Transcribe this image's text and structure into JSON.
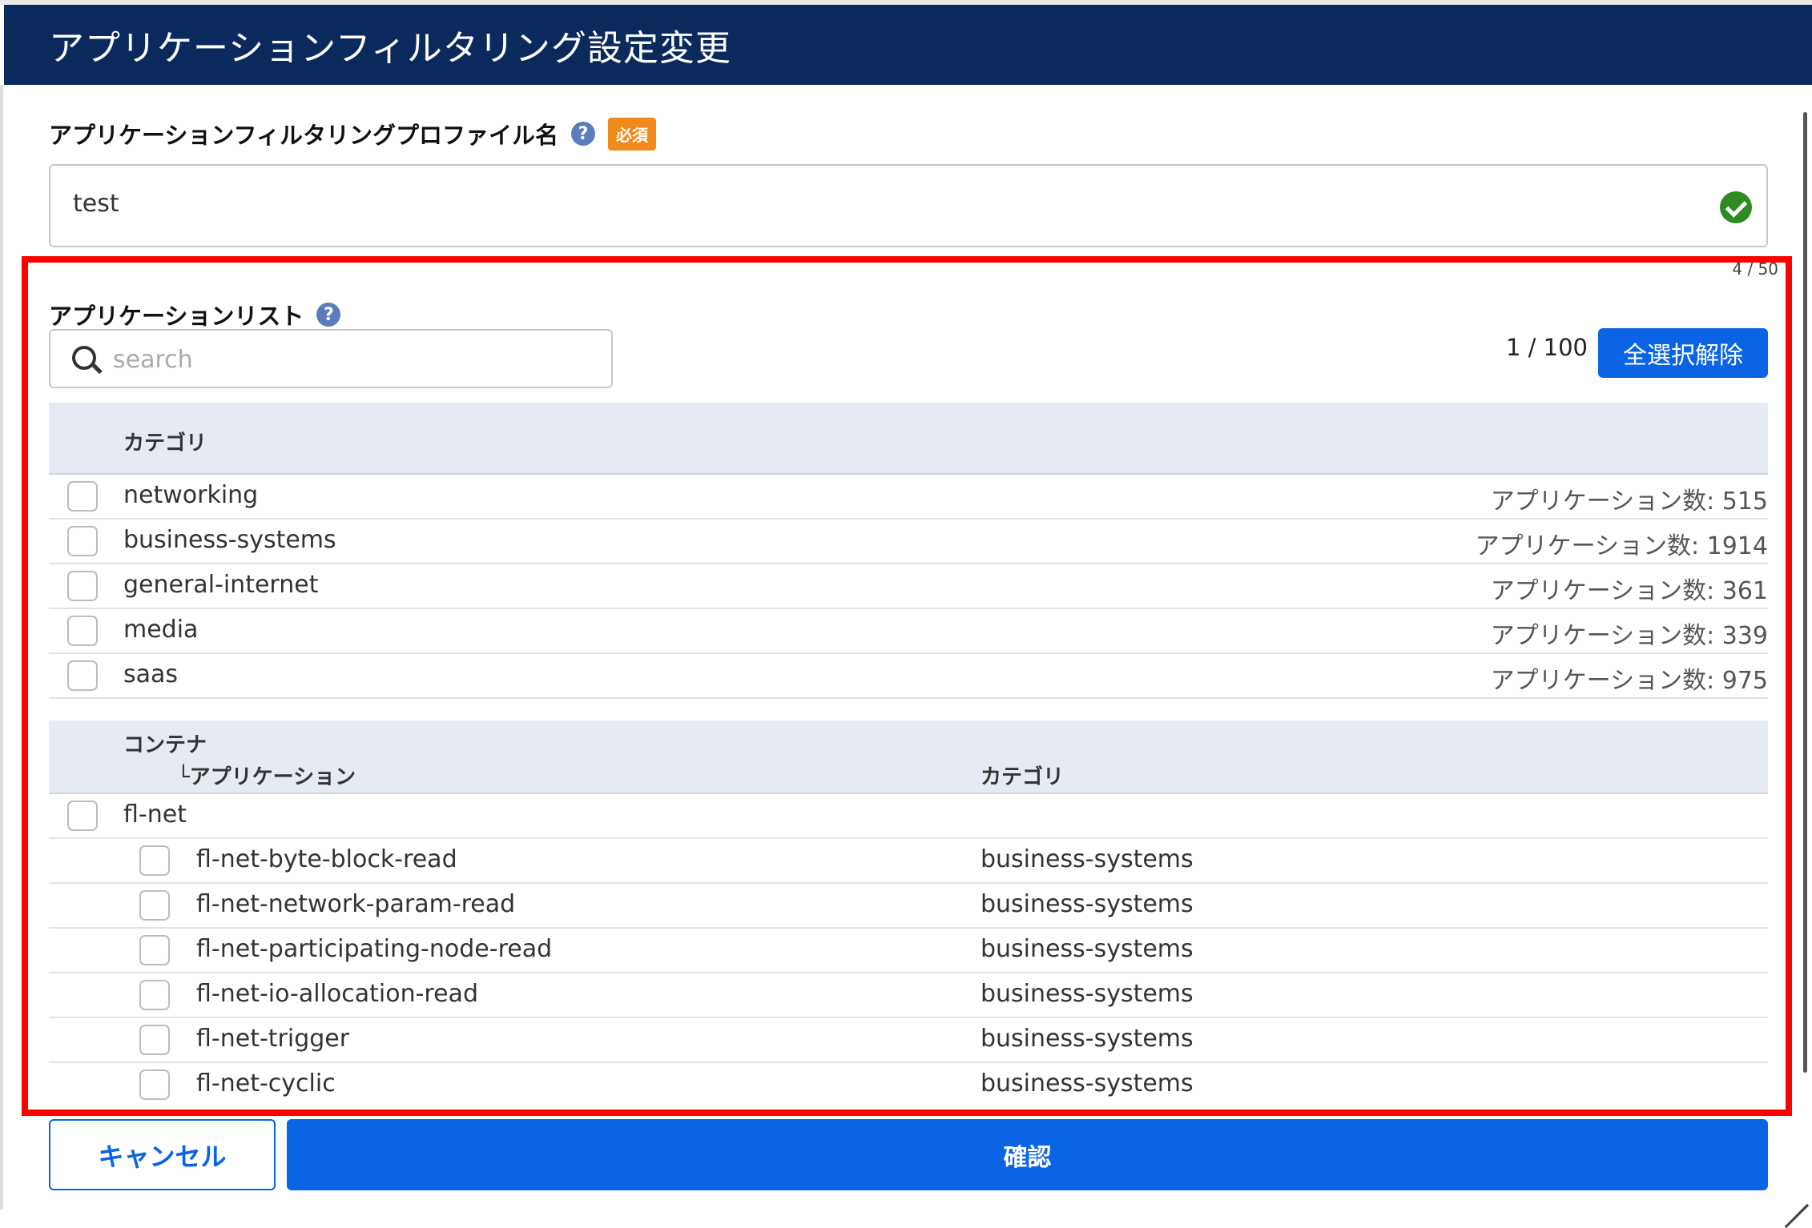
{
  "dialog": {
    "title": "アプリケーションフィルタリング設定変更"
  },
  "profile": {
    "label": "アプリケーションフィルタリングプロファイル名",
    "required_badge": "必須",
    "value": "test",
    "counter": "4 / 50"
  },
  "app_list": {
    "label": "アプリケーションリスト",
    "search_placeholder": "search",
    "selection_count": "1 / 100",
    "deselect_all_label": "全選択解除"
  },
  "category_table": {
    "header": "カテゴリ",
    "rows": [
      {
        "name": "networking",
        "count": "アプリケーション数: 515"
      },
      {
        "name": "business-systems",
        "count": "アプリケーション数: 1914"
      },
      {
        "name": "general-internet",
        "count": "アプリケーション数: 361"
      },
      {
        "name": "media",
        "count": "アプリケーション数: 339"
      },
      {
        "name": "saas",
        "count": "アプリケーション数: 975"
      }
    ]
  },
  "container_table": {
    "header_container": "コンテナ",
    "header_application": "└アプリケーション",
    "header_category": "カテゴリ",
    "container_name": "fl-net",
    "apps": [
      {
        "name": "fl-net-byte-block-read",
        "category": "business-systems"
      },
      {
        "name": "fl-net-network-param-read",
        "category": "business-systems"
      },
      {
        "name": "fl-net-participating-node-read",
        "category": "business-systems"
      },
      {
        "name": "fl-net-io-allocation-read",
        "category": "business-systems"
      },
      {
        "name": "fl-net-trigger",
        "category": "business-systems"
      },
      {
        "name": "fl-net-cyclic",
        "category": "business-systems"
      }
    ]
  },
  "footer": {
    "cancel_label": "キャンセル",
    "confirm_label": "確認"
  }
}
